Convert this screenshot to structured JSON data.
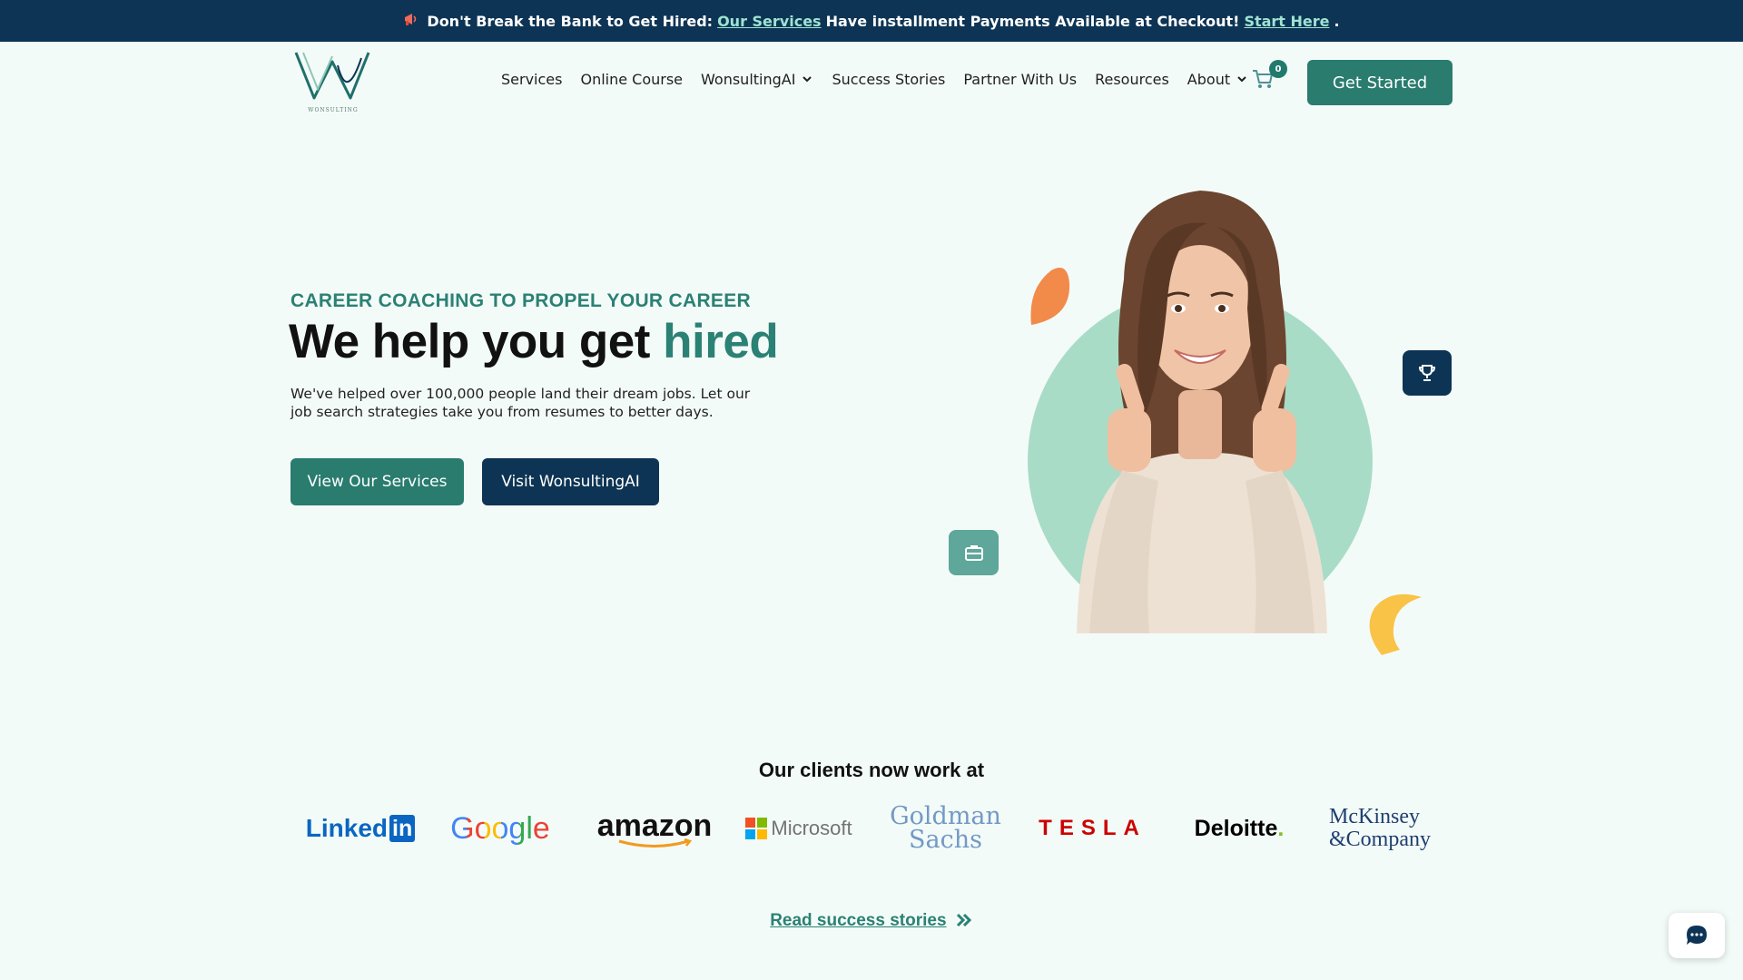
{
  "announcement": {
    "icon": "megaphone-icon",
    "lead": "Don't Break the Bank to Get Hired:",
    "link1": "Our Services",
    "middle": "Have installment Payments Available at Checkout!",
    "link2": "Start Here",
    "tail": "."
  },
  "header": {
    "logo_text": "WONSULTING",
    "nav": [
      {
        "label": "Services",
        "dropdown": false
      },
      {
        "label": "Online Course",
        "dropdown": false
      },
      {
        "label": "WonsultingAI",
        "dropdown": true
      },
      {
        "label": "Success Stories",
        "dropdown": false
      },
      {
        "label": "Partner With Us",
        "dropdown": false
      },
      {
        "label": "Resources",
        "dropdown": false
      },
      {
        "label": "About",
        "dropdown": true
      }
    ],
    "cart_count": "0",
    "cta": "Get Started"
  },
  "hero": {
    "eyebrow": "CAREER COACHING TO PROPEL YOUR CAREER",
    "headline_plain": "We help you get ",
    "headline_accent": "hired",
    "subtext": "We've helped over 100,000 people land their dream jobs. Let our job search strategies take you from resumes to better days.",
    "primary_button": "View Our Services",
    "secondary_button": "Visit WonsultingAI"
  },
  "clients": {
    "title": "Our clients now work at",
    "logos": {
      "linkedin": "Linked",
      "linkedin_in": "in",
      "google": "Google",
      "amazon": "amazon",
      "microsoft": "Microsoft",
      "goldman_1": "Goldman",
      "goldman_2": "Sachs",
      "tesla": "TESLA",
      "deloitte": "Deloitte",
      "deloitte_dot": ".",
      "mckinsey_1": "McKinsey",
      "mckinsey_2": "&Company"
    }
  },
  "footer_link": "Read success stories",
  "colors": {
    "navy": "#0d3454",
    "teal": "#297c6e",
    "mint_circle": "#a9dcc7",
    "orange": "#f28a4a",
    "yellow": "#f8c347",
    "background": "#f3fbf8"
  }
}
